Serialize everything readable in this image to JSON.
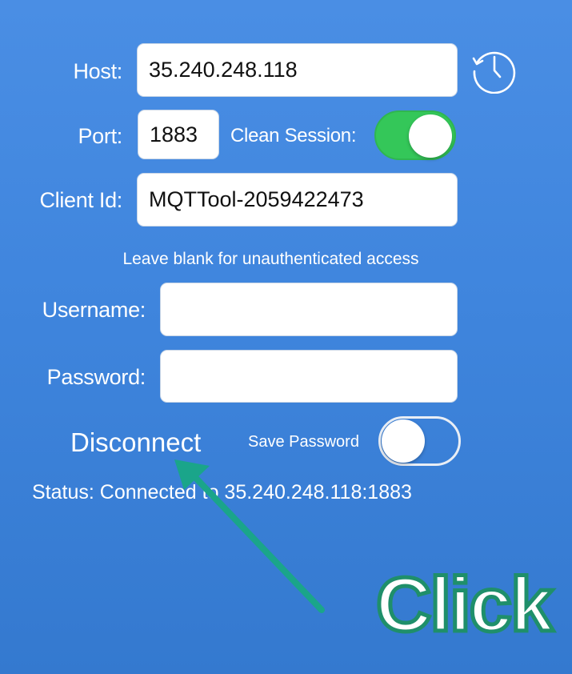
{
  "form": {
    "host_label": "Host:",
    "host_value": "35.240.248.118",
    "port_label": "Port:",
    "port_value": "1883",
    "clean_session_label": "Clean Session:",
    "clean_session_on": true,
    "client_id_label": "Client Id:",
    "client_id_value": "MQTTool-2059422473",
    "auth_hint": "Leave blank for unauthenticated access",
    "username_label": "Username:",
    "username_value": "",
    "password_label": "Password:",
    "password_value": "",
    "disconnect_label": "Disconnect",
    "save_password_label": "Save Password",
    "save_password_on": false,
    "status_text": "Status: Connected to 35.240.248.118:1883"
  },
  "history_icon": "clock-history-icon",
  "annotation": {
    "text": "Click",
    "arrow_color": "#1aa58a",
    "text_fill": "#ffffff",
    "text_stroke": "#1f8f6a"
  },
  "colors": {
    "background_top": "#4a8ee4",
    "background_bottom": "#3479cf",
    "toggle_on": "#34c759"
  }
}
